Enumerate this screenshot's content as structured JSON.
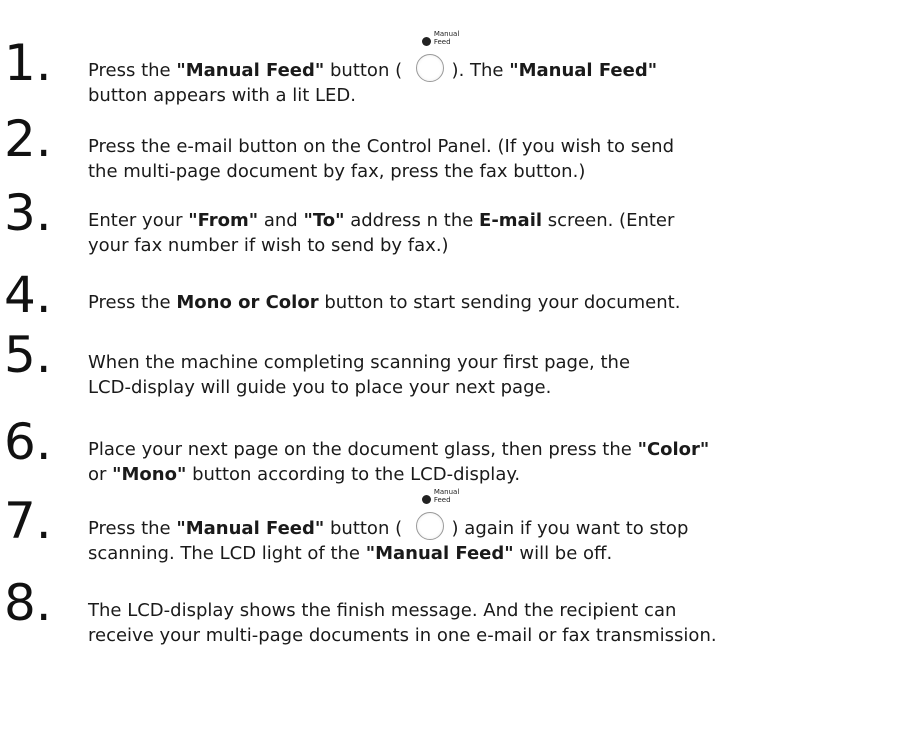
{
  "icon_label": [
    "Manual",
    "Feed"
  ],
  "steps": [
    {
      "num": "1.",
      "lines": [
        [
          {
            "t": "Press the "
          },
          {
            "t": "\"Manual Feed\"",
            "b": true
          },
          {
            "t": " button ( "
          },
          {
            "icon": "manual-feed-button"
          },
          {
            "t": " ).   The "
          },
          {
            "t": "\"Manual Feed\"",
            "b": true
          }
        ],
        [
          {
            "t": "button appears with a lit LED."
          }
        ]
      ]
    },
    {
      "num": "2.",
      "lines": [
        [
          {
            "t": "Press the e-mail button on the Control Panel.  (If you wish to send"
          }
        ],
        [
          {
            "t": "the multi-page document by fax, press the fax button.)"
          }
        ]
      ]
    },
    {
      "num": "3.",
      "lines": [
        [
          {
            "t": "Enter your "
          },
          {
            "t": "\"From\"",
            "b": true
          },
          {
            "t": " and "
          },
          {
            "t": "\"To\"",
            "b": true
          },
          {
            "t": "  address n the "
          },
          {
            "t": "E-mail",
            "b": true
          },
          {
            "t": " screen. (Enter"
          }
        ],
        [
          {
            "t": "your fax number if wish to send by fax.)"
          }
        ]
      ]
    },
    {
      "num": "4.",
      "lines": [
        [
          {
            "t": "Press the "
          },
          {
            "t": "Mono or Color",
            "b": true
          },
          {
            "t": " button to start sending your document."
          }
        ]
      ]
    },
    {
      "num": "5.",
      "lines": [
        [
          {
            "t": "When the machine completing scanning your first page, the"
          }
        ],
        [
          {
            "t": "LCD-display will guide you to place your next page."
          }
        ]
      ]
    },
    {
      "num": "6.",
      "lines": [
        [
          {
            "t": "Place your next page on the document glass, then press the "
          },
          {
            "t": "\"Color\"",
            "b": true
          }
        ],
        [
          {
            "t": "or "
          },
          {
            "t": "\"Mono\"",
            "b": true
          },
          {
            "t": "  button according to the LCD-display."
          }
        ]
      ]
    },
    {
      "num": "7.",
      "lines": [
        [
          {
            "t": "Press the "
          },
          {
            "t": "\"Manual Feed\"",
            "b": true
          },
          {
            "t": " button ( "
          },
          {
            "icon": "manual-feed-button"
          },
          {
            "t": " ) again if you want to stop"
          }
        ],
        [
          {
            "t": "scanning. The LCD light of the "
          },
          {
            "t": "\"Manual Feed\"",
            "b": true
          },
          {
            "t": "  will be off."
          }
        ]
      ]
    },
    {
      "num": "8.",
      "lines": [
        [
          {
            "t": "The LCD-display shows the finish message.  And the recipient can"
          }
        ],
        [
          {
            "t": "receive your multi-page documents in one e-mail or fax transmission."
          }
        ]
      ]
    }
  ]
}
